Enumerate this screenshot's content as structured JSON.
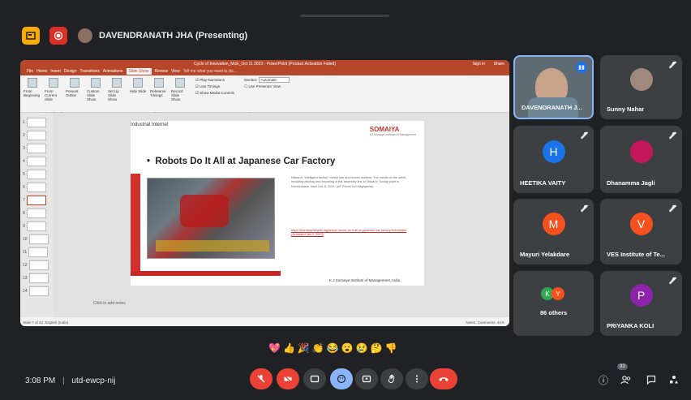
{
  "meeting": {
    "presenter_label": "DAVENDRANATH JHA (Presenting)",
    "time": "3:08 PM",
    "separator": "|",
    "meeting_code": "utd-ewcp-nij"
  },
  "ppt": {
    "window_title": "Cycle of Innovation_MoE_Oct 11 2023 - PowerPoint (Product Activation Failed)",
    "signin": "Sign in",
    "share": "Share",
    "tabs": [
      "File",
      "Home",
      "Insert",
      "Design",
      "Transitions",
      "Animations",
      "Slide Show",
      "Review",
      "View"
    ],
    "active_tab": "Slide Show",
    "tell_me": "Tell me what you want to do...",
    "ribbon": [
      "From Beginning",
      "From Current Slide",
      "Present Online",
      "Custom Slide Show",
      "Set Up Slide Show",
      "Hide Slide",
      "Rehearse Timings",
      "Record Slide Show"
    ],
    "checks": [
      "Play Narrations",
      "Use Timings",
      "Show Media Controls"
    ],
    "monitor_label": "Monitor:",
    "monitor_value": "Automatic",
    "presenter_view": "Use Presenter View",
    "group_labels": [
      "Start Slide Show",
      "Set Up",
      "Monitors"
    ],
    "notes_placeholder": "Click to add notes",
    "status_left": "Slide 7 of 42",
    "status_lang": "English (India)",
    "status_notes": "Notes",
    "status_comments": "Comments",
    "zoom": "41%"
  },
  "slide": {
    "top_label": "Industrial Internet",
    "logo": "SOMAIYA",
    "logo_sub": "KJ Somaiya Institute of Management",
    "heading": "Robots Do It All at Japanese Car Factory",
    "body": "Nissan's \"intelligent factory\" barely has any human workers. The robots on the creek, including welding and mounting of the assembly line at Nissan's Tochigi plant in Kaminokawa, town Oct. 8, 2021. (AP Photo/Yuri Kageyama)",
    "link": "https://learnbusinessbk.org/article-robots-do-it-all-at-japanese-car-factory/405/43/ibm (Accessed Jan 1, 2023)",
    "footer": "K J Somaiya Institute of Management, India"
  },
  "participants": [
    {
      "name": "DAVENDRANATH J...",
      "type": "video"
    },
    {
      "name": "Sunny Nahar",
      "type": "photo"
    },
    {
      "name": "HEETIKA VAITY",
      "initial": "H",
      "color": "#1a73e8"
    },
    {
      "name": "Dhanamma Jagli",
      "type": "photo"
    },
    {
      "name": "Mayuri Yelakdare",
      "initial": "M",
      "color": "#f4511e"
    },
    {
      "name": "VES Institute of Te...",
      "initial": "V",
      "color": "#f4511e"
    },
    {
      "name": "86 others",
      "initials": [
        "K",
        "Y"
      ]
    },
    {
      "name": "PRIYANKA KOLI",
      "initial": "P",
      "color": "#8e24aa"
    }
  ],
  "reactions": [
    "💖",
    "👍",
    "🎉",
    "👏",
    "😂",
    "😮",
    "😢",
    "🤔",
    "👎"
  ],
  "controls": {
    "people_badge": "93"
  }
}
